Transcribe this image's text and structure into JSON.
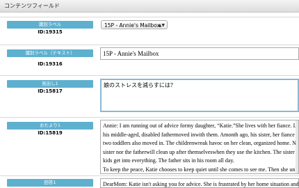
{
  "header": {
    "title": "コンテンツフィールド"
  },
  "fields": [
    {
      "label": "識別ラベル",
      "id": "ID:19315",
      "select_value": "15P - Annie's Mailbox",
      "arrow": "▲▼"
    },
    {
      "label": "識別ラベル（テキスト）",
      "id": "ID:19316",
      "value": "15P - Annie's Mailbox"
    },
    {
      "label": "見出し1",
      "id": "ID:15817",
      "value": "娘のストレスを減らすには？"
    },
    {
      "label": "おたより1",
      "id": "ID:15819",
      "lines": [
        "Annie:  I am running out of advice formy daughter, “Katie.”She lives with her fiance. Last y",
        "his middle-aged, disabled fathermoved inwith them. Amonth ago, his sister, her fiance and t",
        "two toddlers also moved in. The childrenwreak havoc on her clean, organized home.  Neithe",
        "sister nor the fatherwill clean up after themselveswhen they use the kitchen. The sister lets h",
        "kids get into everything. The father sits in his room all day.",
        "To keep the peace, Katie chooses to keep quiet until she comes to see me.  Then she unload"
      ]
    },
    {
      "label": "回答1",
      "lines": [
        "DearMom: Katie isn't asking you for advice. She is frustrated by her home situation and is"
      ]
    }
  ]
}
